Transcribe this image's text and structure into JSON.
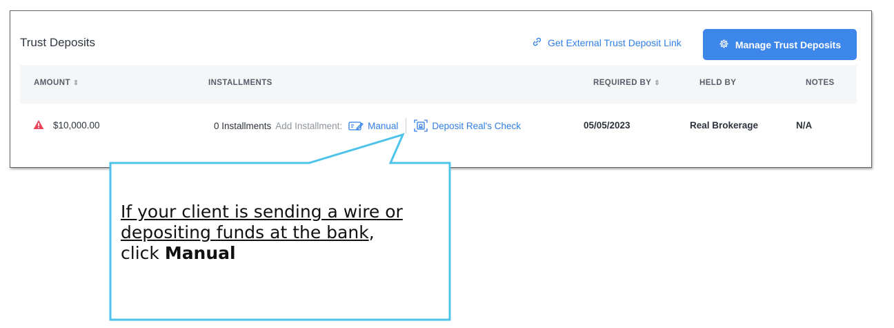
{
  "panel": {
    "title": "Trust Deposits",
    "external_link_label": "Get External Trust Deposit Link",
    "manage_button_label": "Manage Trust Deposits"
  },
  "table": {
    "columns": {
      "amount": "AMOUNT",
      "installments": "INSTALLMENTS",
      "required_by": "REQUIRED BY",
      "held_by": "HELD BY",
      "notes": "NOTES"
    },
    "row": {
      "amount": "$10,000.00",
      "installments_count": "0 Installments",
      "add_installment_label": "Add Installment:",
      "manual_label": "Manual",
      "deposit_check_label": "Deposit Real's Check",
      "required_by": "05/05/2023",
      "held_by": "Real Brokerage",
      "notes": "N/A"
    }
  },
  "callout": {
    "line1": "If your client is sending a wire or",
    "line2": "depositing funds at the bank",
    "line2_suffix": ",",
    "line3_prefix": "click ",
    "line3_bold": "Manual"
  },
  "colors": {
    "accent": "#3d86ea",
    "link": "#2f7ee6",
    "warning": "#e8455a",
    "callout_border": "#4dc3ea"
  },
  "icons": {
    "link": "link-icon",
    "gear": "gear-icon",
    "sort": "sort-icon",
    "warning": "warning-icon",
    "manual": "check-pen-icon",
    "deposit": "check-scan-icon"
  }
}
